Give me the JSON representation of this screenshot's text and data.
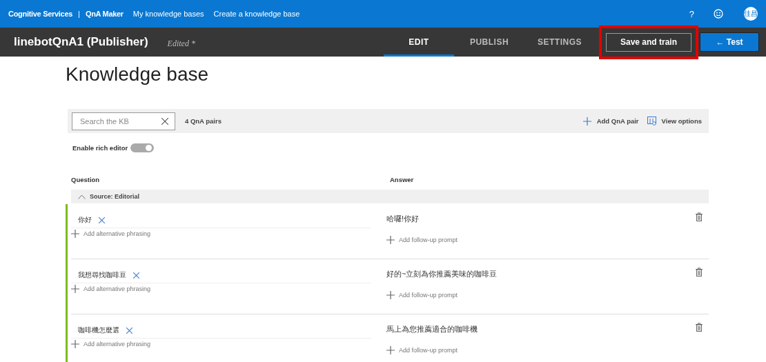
{
  "top_bar": {
    "brand": "Cognitive Services",
    "separator": "|",
    "product": "QnA Maker",
    "links": [
      "My knowledge bases",
      "Create a knowledge base"
    ],
    "help": "?",
    "avatar": "佳昌"
  },
  "kb_bar": {
    "title": "linebotQnA1 (Publisher)",
    "status": "Edited *",
    "tabs": [
      {
        "label": "EDIT",
        "selected": true
      },
      {
        "label": "PUBLISH",
        "selected": false
      },
      {
        "label": "SETTINGS",
        "selected": false
      }
    ],
    "save_button": {
      "label": "Save and train",
      "highlighted": true
    },
    "test_button": {
      "label": "← Test"
    }
  },
  "heading": "Knowledge base",
  "toolbar": {
    "search": {
      "placeholder": "Search the KB"
    },
    "count": "4 QnA pairs",
    "add": "Add QnA pair",
    "view": "View options"
  },
  "rich_editor": {
    "label": "Enable rich editor",
    "on": true
  },
  "columns": [
    "Question",
    "Answer"
  ],
  "group": {
    "label": "Source: Editorial",
    "expanded": true
  },
  "pairs": [
    {
      "question": "你好",
      "alt": "Add alternative phrasing",
      "answer": "哈囉!你好",
      "follow": "Add follow-up prompt"
    },
    {
      "question": "我想尋找咖啡豆",
      "alt": "Add alternative phrasing",
      "answer": "好的~立刻為你推薦美味的咖啡豆",
      "follow": "Add follow-up prompt"
    },
    {
      "question": "咖啡機怎麼選",
      "alt": "Add alternative phrasing",
      "answer": "馬上為您推薦適合的咖啡機",
      "follow": "Add follow-up prompt"
    }
  ]
}
